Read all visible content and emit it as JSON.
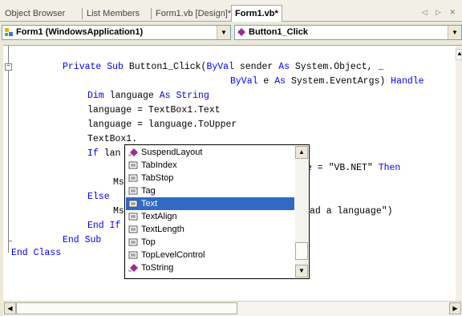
{
  "tabs": [
    {
      "label": "Object Browser"
    },
    {
      "label": "List Members"
    },
    {
      "label": "Form1.vb [Design]*"
    },
    {
      "label": "Form1.vb*"
    }
  ],
  "nav_arrows": "◁ ▷ ✕",
  "class_combo": {
    "value": "Form1 (WindowsApplication1)"
  },
  "method_combo": {
    "value": "Button1_Click"
  },
  "code": {
    "l1_kw1": "Private Sub ",
    "l1_txt": "Button1_Click(",
    "l1_kw2": "ByVal",
    "l1_txt2": " sender ",
    "l1_kw3": "As",
    "l1_txt3": " System.Object, _",
    "l2_kw1": "ByVal",
    "l2_txt": " e ",
    "l2_kw2": "As",
    "l2_txt2": " System.EventArgs) ",
    "l2_kw3": "Handle",
    "l3_kw1": "Dim",
    "l3_txt": " language ",
    "l3_kw2": "As String",
    "l4": "language = TextBox1.Text",
    "l5": "language = language.ToUpper",
    "l6": "TextBox1.",
    "l7_kw": "If",
    "l7_txt": " lan",
    "l7_tail": "e = \"VB.NET\" ",
    "l7_kw2": "Then",
    "l8": "Ms",
    "l9_kw": "Else",
    "l10": "Ms",
    "l10_tail": "ad a language\")",
    "l11_kw": "End If",
    "l12_kw": "End Sub",
    "l13_kw": "End Class"
  },
  "popup": {
    "items": [
      {
        "label": "SuspendLayout",
        "icon": "method-icon"
      },
      {
        "label": "TabIndex",
        "icon": "property-icon"
      },
      {
        "label": "TabStop",
        "icon": "property-icon"
      },
      {
        "label": "Tag",
        "icon": "property-icon"
      },
      {
        "label": "Text",
        "icon": "property-icon"
      },
      {
        "label": "TextAlign",
        "icon": "property-icon"
      },
      {
        "label": "TextLength",
        "icon": "property-icon"
      },
      {
        "label": "Top",
        "icon": "property-icon"
      },
      {
        "label": "TopLevelControl",
        "icon": "property-icon"
      },
      {
        "label": "ToString",
        "icon": "method-icon"
      }
    ],
    "selected": "Text"
  },
  "colors": {
    "keyword": "#0000ff",
    "selection": "#316ac5",
    "method_icon": "#9b2d8f"
  }
}
